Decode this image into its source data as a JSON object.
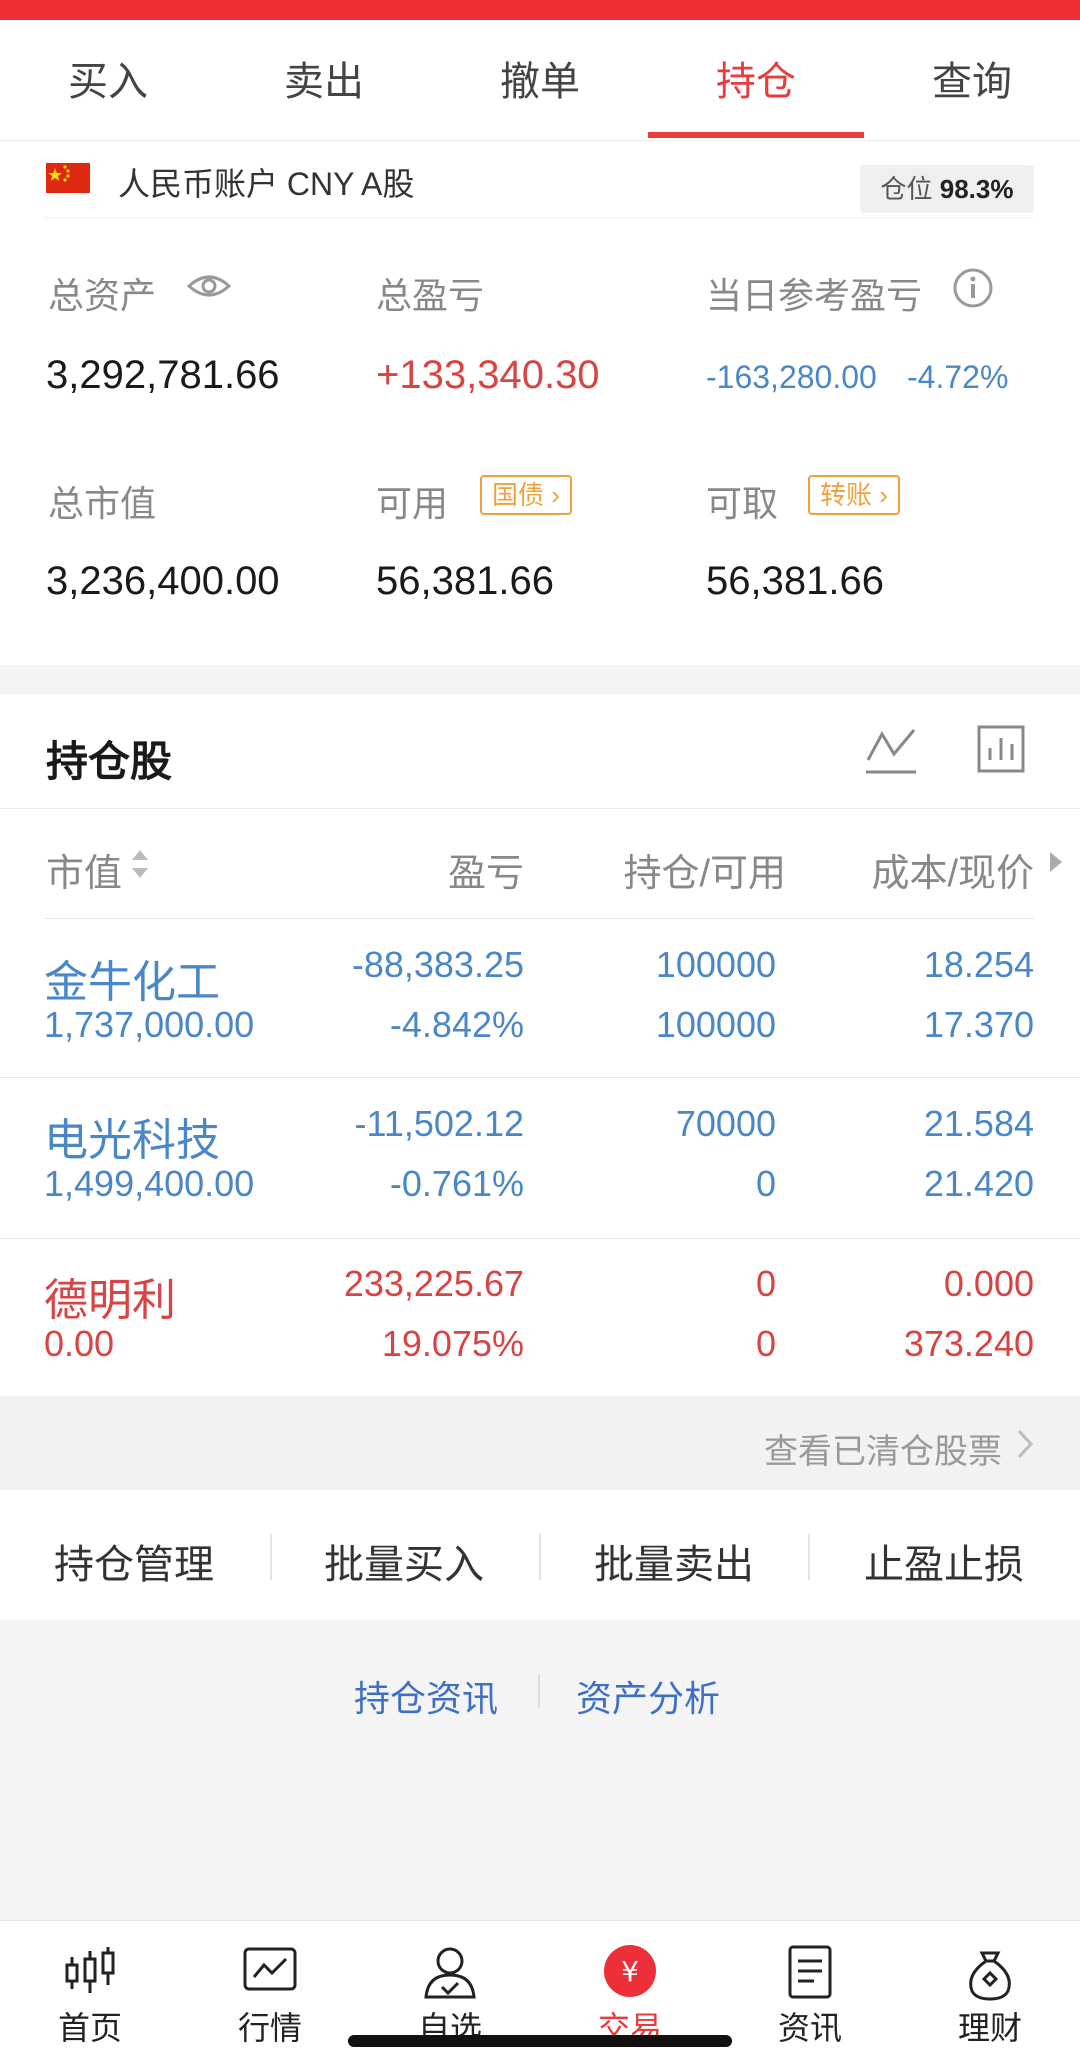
{
  "tabs": [
    "买入",
    "卖出",
    "撤单",
    "持仓",
    "查询"
  ],
  "account": {
    "name": "人民币账户 CNY A股",
    "position_label": "仓位",
    "position_value": "98.3%",
    "total_assets_label": "总资产",
    "total_assets": "3,292,781.66",
    "total_pnl_label": "总盈亏",
    "total_pnl": "+133,340.30",
    "daily_pnl_label": "当日参考盈亏",
    "daily_pnl": "-163,280.00",
    "daily_pnl_pct": "-4.72%",
    "market_value_label": "总市值",
    "market_value": "3,236,400.00",
    "available_label": "可用",
    "available_tag": "国债",
    "available": "56,381.66",
    "withdrawable_label": "可取",
    "withdrawable_tag": "转账",
    "withdrawable": "56,381.66"
  },
  "holdings": {
    "title": "持仓股",
    "headers": {
      "market_value": "市值",
      "pnl": "盈亏",
      "position": "持仓/可用",
      "cost": "成本/现价"
    },
    "rows": [
      {
        "name": "金牛化工",
        "market_value": "1,737,000.00",
        "pnl": "-88,383.25",
        "pnl_pct": "-4.842%",
        "position": "100000",
        "available": "100000",
        "cost": "18.254",
        "price": "17.370",
        "color": "#4a87c9"
      },
      {
        "name": "电光科技",
        "market_value": "1,499,400.00",
        "pnl": "-11,502.12",
        "pnl_pct": "-0.761%",
        "position": "70000",
        "available": "0",
        "cost": "21.584",
        "price": "21.420",
        "color": "#4a87c9"
      },
      {
        "name": "德明利",
        "market_value": "0.00",
        "pnl": "233,225.67",
        "pnl_pct": "19.075%",
        "position": "0",
        "available": "0",
        "cost": "0.000",
        "price": "373.240",
        "color": "#d84343"
      }
    ],
    "view_cleared": "查看已清仓股票"
  },
  "actions": [
    "持仓管理",
    "批量买入",
    "批量卖出",
    "止盈止损"
  ],
  "links": [
    "持仓资讯",
    "资产分析"
  ],
  "bottom_nav": [
    {
      "label": "首页",
      "icon": "candlestick-icon"
    },
    {
      "label": "行情",
      "icon": "chart-icon"
    },
    {
      "label": "自选",
      "icon": "user-check-icon"
    },
    {
      "label": "交易",
      "icon": "yen-icon"
    },
    {
      "label": "资讯",
      "icon": "document-icon"
    },
    {
      "label": "理财",
      "icon": "moneybag-icon"
    }
  ],
  "colors": {
    "accent": "#e83b3b",
    "up": "#d84343",
    "down": "#4a87c9",
    "tag": "#f2a23a"
  }
}
